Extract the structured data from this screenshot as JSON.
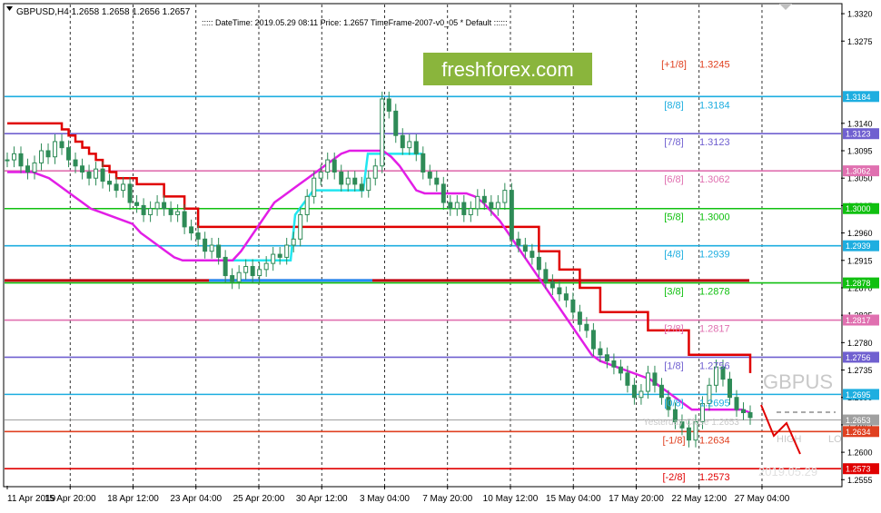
{
  "header": {
    "symbol_info": "GBPUSD,H4  1.2658 1.2658 1.2656 1.2657",
    "indicator_info": "::::: DateTime: 2019.05.29 08:11    Price: 1.2657    TimeFrame-2007-v0_05    *  Default  ::::::"
  },
  "watermark": {
    "logo_text": "freshforex.com",
    "symbol_text": "GBPUS",
    "date_text": "2019.05.29",
    "high_text": "HIGH",
    "low_text": "LO",
    "yesterday_close_text": "Yesterday Close 1.2653"
  },
  "colors": {
    "background": "#ffffff",
    "candle": "#2e8b57",
    "trend_red": "#e00000",
    "trend_cyan": "#22e6f0",
    "trend_blue": "#1040e0",
    "trend_magenta": "#e21ee6",
    "logo_bg": "#8ab53c"
  },
  "murrey_levels": [
    {
      "label": "[+1/8]",
      "price": "1.3245",
      "color": "#e04020"
    },
    {
      "label": "[8/8]",
      "price": "1.3184",
      "color": "#1eaee0"
    },
    {
      "label": "[7/8]",
      "price": "1.3123",
      "color": "#7060d0"
    },
    {
      "label": "[6/8]",
      "price": "1.3062",
      "color": "#e070b0"
    },
    {
      "label": "[5/8]",
      "price": "1.3000",
      "color": "#10c010"
    },
    {
      "label": "[4/8]",
      "price": "1.2939",
      "color": "#1eaee0"
    },
    {
      "label": "[3/8]",
      "price": "1.2878",
      "color": "#10c010"
    },
    {
      "label": "[2/8]",
      "price": "1.2817",
      "color": "#e070b0"
    },
    {
      "label": "[1/8]",
      "price": "1.2756",
      "color": "#7060d0"
    },
    {
      "label": "[0/8]",
      "price": "1.2695",
      "color": "#1eaee0"
    },
    {
      "label": "[-1/8]",
      "price": "1.2634",
      "color": "#e04020"
    },
    {
      "label": "[-2/8]",
      "price": "1.2573",
      "color": "#e00000"
    }
  ],
  "price_axis": {
    "ticks": [
      "1.3320",
      "1.3275",
      "1.3140",
      "1.3095",
      "1.3050",
      "1.3005",
      "1.2960",
      "1.2915",
      "1.2870",
      "1.2825",
      "1.2780",
      "1.2735",
      "1.2690",
      "1.2645",
      "1.2600",
      "1.2555"
    ],
    "tags": [
      {
        "value": "1.3184",
        "color": "#1eaee0"
      },
      {
        "value": "1.3123",
        "color": "#7060d0"
      },
      {
        "value": "1.3062",
        "color": "#e070b0"
      },
      {
        "value": "1.3000",
        "color": "#10c010"
      },
      {
        "value": "1.2939",
        "color": "#1eaee0"
      },
      {
        "value": "1.2878",
        "color": "#10c010"
      },
      {
        "value": "1.2817",
        "color": "#e070b0"
      },
      {
        "value": "1.2756",
        "color": "#7060d0"
      },
      {
        "value": "1.2695",
        "color": "#1eaee0"
      },
      {
        "value": "1.2653",
        "color": "#a0a0a0"
      },
      {
        "value": "1.2634",
        "color": "#e04020"
      },
      {
        "value": "1.2573",
        "color": "#e00000"
      }
    ]
  },
  "time_axis": {
    "labels": [
      "11 Apr 2019",
      "15 Apr 20:00",
      "18 Apr 12:00",
      "23 Apr 04:00",
      "25 Apr 20:00",
      "30 Apr 12:00",
      "3 May 04:00",
      "7 May 20:00",
      "10 May 12:00",
      "15 May 04:00",
      "17 May 20:00",
      "22 May 12:00",
      "27 May 04:00"
    ]
  },
  "chart_data": {
    "type": "candlestick",
    "ylim": [
      1.2545,
      1.3335
    ],
    "price_path": [
      1.308,
      1.309,
      1.307,
      1.306,
      1.3075,
      1.3095,
      1.3085,
      1.311,
      1.31,
      1.308,
      1.307,
      1.306,
      1.305,
      1.3065,
      1.3045,
      1.304,
      1.303,
      1.304,
      1.301,
      1.3005,
      1.299,
      1.3,
      1.301,
      1.3,
      1.299,
      1.2995,
      1.297,
      1.296,
      1.295,
      1.293,
      1.294,
      1.292,
      1.289,
      1.288,
      1.2895,
      1.2905,
      1.289,
      1.29,
      1.291,
      1.2925,
      1.292,
      1.294,
      1.295,
      1.299,
      1.302,
      1.305,
      1.306,
      1.308,
      1.306,
      1.304,
      1.305,
      1.304,
      1.303,
      1.305,
      1.307,
      1.318,
      1.316,
      1.312,
      1.31,
      1.311,
      1.309,
      1.306,
      1.305,
      1.304,
      1.301,
      1.3,
      1.301,
      1.299,
      1.3,
      1.302,
      1.301,
      1.3,
      1.301,
      1.303,
      1.295,
      1.294,
      1.293,
      1.292,
      1.29,
      1.288,
      1.287,
      1.286,
      1.285,
      1.283,
      1.281,
      1.28,
      1.277,
      1.276,
      1.275,
      1.274,
      1.273,
      1.271,
      1.269,
      1.27,
      1.273,
      1.271,
      1.269,
      1.267,
      1.265,
      1.264,
      1.262,
      1.265,
      1.268,
      1.271,
      1.274,
      1.272,
      1.269,
      1.267,
      1.2665,
      1.2657
    ],
    "red_line": [
      [
        1.314,
        1.314,
        1.314,
        1.314,
        1.314,
        1.314,
        1.314,
        1.314,
        1.313,
        1.312
      ],
      [
        1.311,
        1.31,
        1.309,
        1.308,
        1.307,
        1.306,
        1.305,
        1.305,
        1.305,
        1.304
      ],
      [
        1.304,
        1.304,
        1.304,
        1.302,
        1.302,
        1.302,
        1.3,
        1.3,
        1.297,
        1.297
      ],
      [
        1.297,
        1.297,
        1.297,
        1.297,
        1.297,
        1.297,
        1.297,
        1.297,
        1.297,
        1.297
      ],
      [
        1.297,
        1.297,
        1.297,
        1.297,
        1.297,
        1.297,
        1.297,
        1.297,
        1.297,
        1.297
      ],
      [
        1.297,
        1.297,
        1.297,
        1.297,
        1.297,
        1.297,
        1.297,
        1.297,
        1.297,
        1.297
      ],
      [
        1.297,
        1.297,
        1.297,
        1.297,
        1.297,
        1.297,
        1.297,
        1.297,
        1.297,
        1.297
      ],
      [
        1.297,
        1.297,
        1.297,
        1.297,
        1.297,
        1.297,
        1.297,
        1.297,
        1.293,
        1.293
      ],
      [
        1.293,
        1.29,
        1.29,
        1.29,
        1.287,
        1.287,
        1.287,
        1.283,
        1.283,
        1.283
      ],
      [
        1.283,
        1.283,
        1.283,
        1.283,
        1.28,
        1.28,
        1.28,
        1.28,
        1.28,
        1.28
      ],
      [
        1.276,
        1.276,
        1.276,
        1.276,
        1.276,
        1.276,
        1.276,
        1.276,
        1.276,
        1.273
      ]
    ],
    "cyan_line": [
      1.306,
      1.306,
      1.306,
      1.306,
      1.306,
      1.306,
      1.306,
      1.306,
      1.306,
      1.306
    ],
    "magenta_line": [
      1.306,
      1.306,
      1.306,
      1.306,
      1.3055,
      1.305,
      1.304,
      1.303,
      1.302,
      1.301,
      1.3,
      1.2995,
      1.299,
      1.2985,
      1.298,
      1.2975,
      1.296,
      1.295,
      1.294,
      1.293,
      1.292,
      1.2915,
      1.2915,
      1.2915,
      1.2915,
      1.2915,
      1.2915,
      1.2915,
      1.293,
      1.295,
      1.297,
      1.299,
      1.301,
      1.302,
      1.303,
      1.304,
      1.305,
      1.306,
      1.307,
      1.308,
      1.309,
      1.3095,
      1.3095,
      1.3095,
      1.3095,
      1.3095,
      1.3085,
      1.307,
      1.305,
      1.303,
      1.3025,
      1.3025,
      1.3025,
      1.3025,
      1.3025,
      1.3025,
      1.302,
      1.301,
      1.2995,
      1.298,
      1.296,
      1.294,
      1.292,
      1.29,
      1.288,
      1.286,
      1.284,
      1.282,
      1.28,
      1.278,
      1.276,
      1.275,
      1.2745,
      1.274,
      1.2735,
      1.273,
      1.2725,
      1.272,
      1.271,
      1.27,
      1.269,
      1.268,
      1.267,
      1.267,
      1.267,
      1.267,
      1.267,
      1.267,
      1.267,
      1.2665
    ]
  }
}
